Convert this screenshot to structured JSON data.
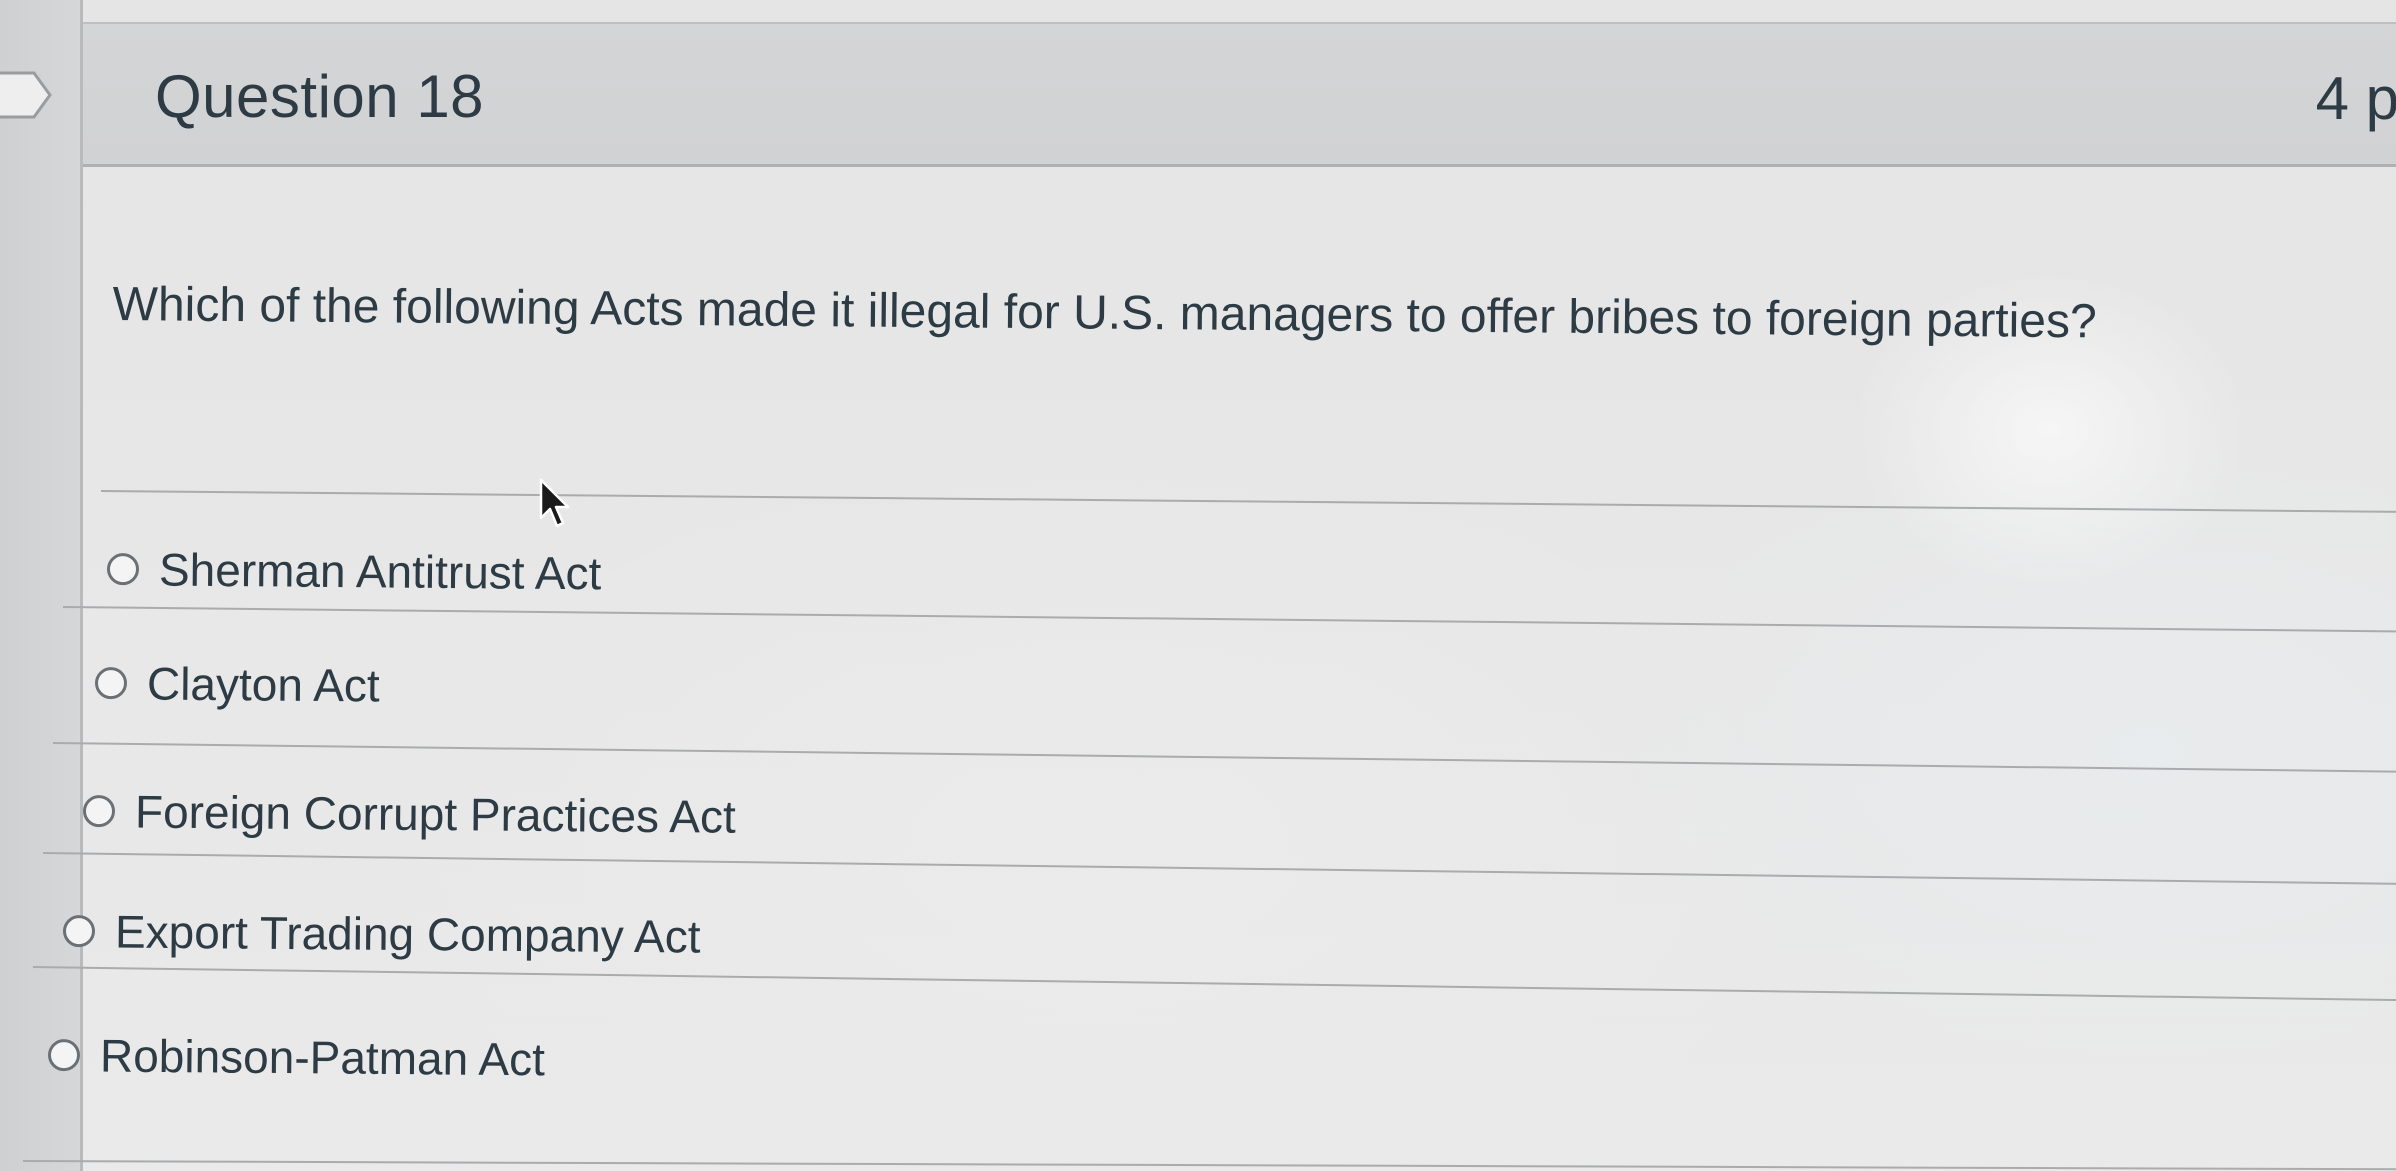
{
  "question": {
    "title": "Question 18",
    "points": "4 p",
    "text": "Which of the following Acts made it illegal for U.S. managers to offer bribes to foreign parties?"
  },
  "answers": [
    {
      "label": "Sherman Antitrust Act",
      "selected": false
    },
    {
      "label": "Clayton Act",
      "selected": false
    },
    {
      "label": "Foreign Corrupt Practices Act",
      "selected": false
    },
    {
      "label": "Export Trading Company Act",
      "selected": false
    },
    {
      "label": "Robinson-Patman Act",
      "selected": false
    }
  ],
  "colors": {
    "text": "#2d3b45",
    "header_bg": "#d2d3d4",
    "divider": "#a9abad",
    "radio_border": "#6b7075"
  },
  "icons": {
    "flag": "flag-icon",
    "cursor": "mouse-pointer-icon"
  }
}
